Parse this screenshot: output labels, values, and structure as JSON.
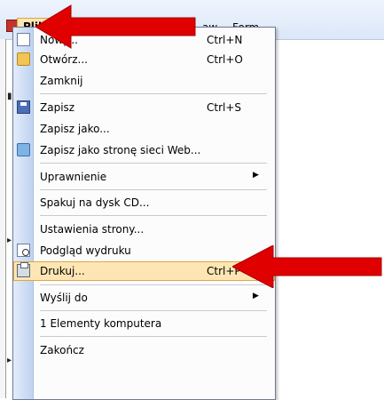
{
  "menubar": {
    "items": [
      {
        "label": "Plik"
      },
      {
        "label": "aw"
      },
      {
        "label": "Form"
      }
    ]
  },
  "menu": {
    "items": [
      {
        "label": "Nowy...",
        "shortcut": "Ctrl+N",
        "icon": "new-document-icon"
      },
      {
        "label": "Otwórz...",
        "shortcut": "Ctrl+O",
        "icon": "open-folder-icon"
      },
      {
        "label": "Zamknij",
        "shortcut": "",
        "icon": ""
      },
      {
        "label": "Zapisz",
        "shortcut": "Ctrl+S",
        "icon": "save-disk-icon"
      },
      {
        "label": "Zapisz jako...",
        "shortcut": "",
        "icon": ""
      },
      {
        "label": "Zapisz jako stronę sieci Web...",
        "shortcut": "",
        "icon": "web-page-icon"
      },
      {
        "label": "Uprawnienie",
        "shortcut": "",
        "icon": "",
        "submenu": true
      },
      {
        "label": "Spakuj na dysk CD...",
        "shortcut": "",
        "icon": ""
      },
      {
        "label": "Ustawienia strony...",
        "shortcut": "",
        "icon": ""
      },
      {
        "label": "Podgląd wydruku",
        "shortcut": "",
        "icon": "print-preview-icon"
      },
      {
        "label": "Drukuj...",
        "shortcut": "Ctrl+P",
        "icon": "printer-icon",
        "highlighted": true
      },
      {
        "label": "Wyślij do",
        "shortcut": "",
        "icon": "",
        "submenu": true
      },
      {
        "label": "1 Elementy komputera",
        "shortcut": "",
        "icon": ""
      },
      {
        "label": "Zakończ",
        "shortcut": "",
        "icon": ""
      }
    ],
    "submenu_arrow": "▶"
  },
  "colors": {
    "highlight_bg": "#fde6b4",
    "highlight_border": "#e2a449",
    "annotation_arrow": "#e00000"
  }
}
